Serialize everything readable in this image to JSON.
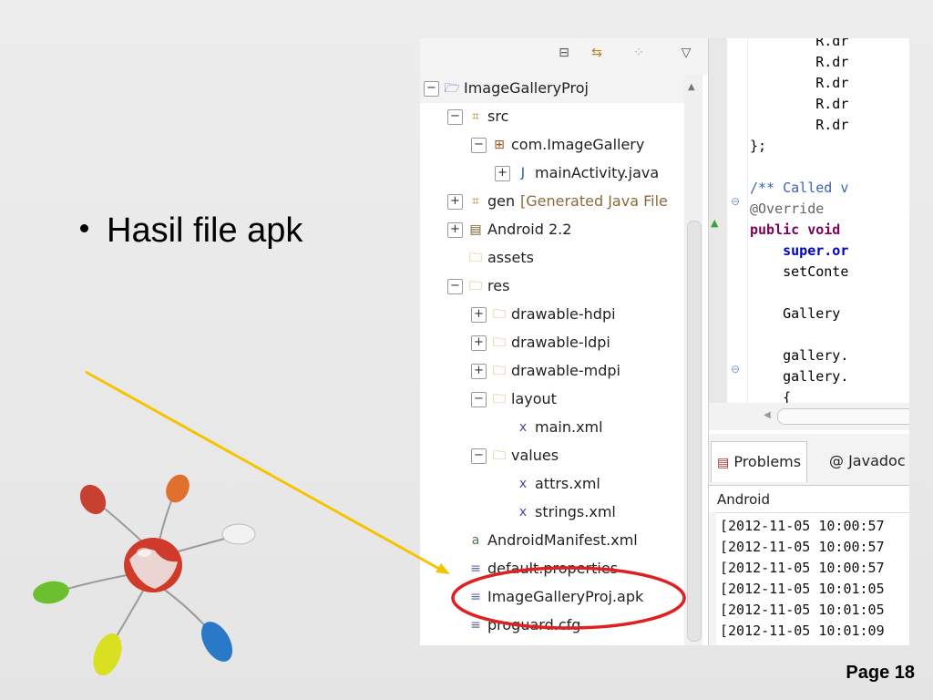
{
  "slide": {
    "bullet": "Hasil file apk",
    "page_label": "Page 18"
  },
  "tree": {
    "rows": [
      {
        "label": "ImageGalleryProj",
        "toggle": "−",
        "icon": "project-folder-icon"
      },
      {
        "label": "src",
        "toggle": "−",
        "icon": "source-folder-icon"
      },
      {
        "label": "com.ImageGallery",
        "toggle": "−",
        "icon": "package-icon"
      },
      {
        "label": "mainActivity.java",
        "toggle": "+",
        "icon": "java-file-icon"
      },
      {
        "label": "gen",
        "decoration": "[Generated Java File",
        "toggle": "+",
        "icon": "source-folder-icon"
      },
      {
        "label": "Android 2.2",
        "toggle": "+",
        "icon": "library-icon"
      },
      {
        "label": "assets",
        "toggle": "",
        "icon": "folder-icon"
      },
      {
        "label": "res",
        "toggle": "−",
        "icon": "folder-icon"
      },
      {
        "label": "drawable-hdpi",
        "toggle": "+",
        "icon": "folder-icon"
      },
      {
        "label": "drawable-ldpi",
        "toggle": "+",
        "icon": "folder-icon"
      },
      {
        "label": "drawable-mdpi",
        "toggle": "+",
        "icon": "folder-icon"
      },
      {
        "label": "layout",
        "toggle": "−",
        "icon": "folder-icon"
      },
      {
        "label": "main.xml",
        "toggle": "",
        "icon": "xml-file-icon"
      },
      {
        "label": "values",
        "toggle": "−",
        "icon": "folder-icon"
      },
      {
        "label": "attrs.xml",
        "toggle": "",
        "icon": "xml-file-icon"
      },
      {
        "label": "strings.xml",
        "toggle": "",
        "icon": "xml-file-icon"
      },
      {
        "label": "AndroidManifest.xml",
        "toggle": "",
        "icon": "manifest-file-icon"
      },
      {
        "label": "default.properties",
        "toggle": "",
        "icon": "text-file-icon"
      },
      {
        "label": "ImageGalleryProj.apk",
        "toggle": "",
        "icon": "text-file-icon"
      },
      {
        "label": "proguard.cfg",
        "toggle": "",
        "icon": "text-file-icon"
      }
    ]
  },
  "editor": {
    "lines": [
      "        R.dr",
      "        R.dr",
      "        R.dr",
      "        R.dr",
      "        R.dr",
      "};",
      "",
      "/** Called v",
      "@Override",
      "public void ",
      "    super.or",
      "    setConte",
      "",
      "    Gallery ",
      "",
      "    gallery.",
      "    gallery.",
      "    {"
    ]
  },
  "console": {
    "tabs": [
      "Problems",
      "@ Javadoc"
    ],
    "title": "Android",
    "lines": [
      "[2012-11-05 10:00:57",
      "[2012-11-05 10:00:57",
      "[2012-11-05 10:00:57",
      "[2012-11-05 10:01:05",
      "[2012-11-05 10:01:05",
      "[2012-11-05 10:01:09"
    ]
  },
  "colors": {
    "arrow": "#f5c400",
    "highlight_circle": "#e02020",
    "keyword": "#7f0055",
    "comment": "#3f5fbf"
  }
}
